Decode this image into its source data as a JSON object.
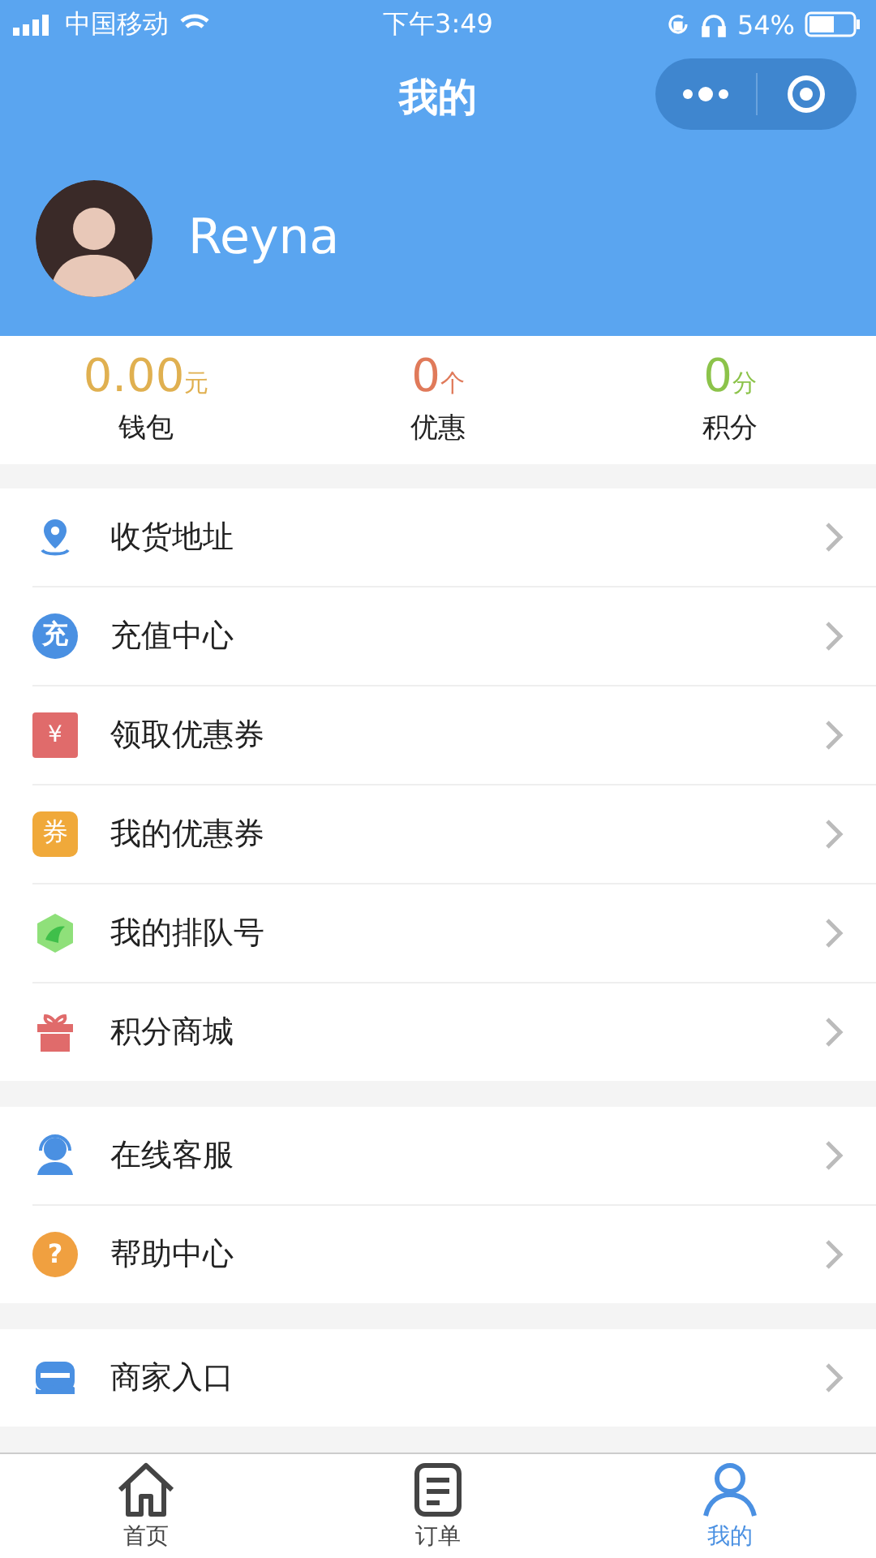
{
  "status_bar": {
    "carrier": "中国移动",
    "time": "下午3:49",
    "battery": "54%"
  },
  "nav": {
    "title": "我的"
  },
  "profile": {
    "name": "Reyna"
  },
  "stats": [
    {
      "value": "0.00",
      "unit": "元",
      "label": "钱包",
      "color": "#e0b050"
    },
    {
      "value": "0",
      "unit": "个",
      "label": "优惠",
      "color": "#e07a5a"
    },
    {
      "value": "0",
      "unit": "分",
      "label": "积分",
      "color": "#8cc34a"
    }
  ],
  "menu_groups": [
    [
      {
        "kind": "location",
        "label": "收货地址"
      },
      {
        "kind": "recharge",
        "label": "充值中心",
        "icon_text": "充"
      },
      {
        "kind": "ticket",
        "label": "领取优惠券",
        "icon_text": "¥"
      },
      {
        "kind": "coupon",
        "label": "我的优惠券",
        "icon_text": "券"
      },
      {
        "kind": "queue",
        "label": "我的排队号"
      },
      {
        "kind": "gift",
        "label": "积分商城"
      }
    ],
    [
      {
        "kind": "service",
        "label": "在线客服"
      },
      {
        "kind": "help",
        "label": "帮助中心",
        "icon_text": "?"
      }
    ],
    [
      {
        "kind": "shop",
        "label": "商家入口"
      }
    ]
  ],
  "tab_bar": [
    {
      "kind": "home",
      "label": "首页",
      "selected": false
    },
    {
      "kind": "orders",
      "label": "订单",
      "selected": false
    },
    {
      "kind": "me",
      "label": "我的",
      "selected": true
    }
  ]
}
